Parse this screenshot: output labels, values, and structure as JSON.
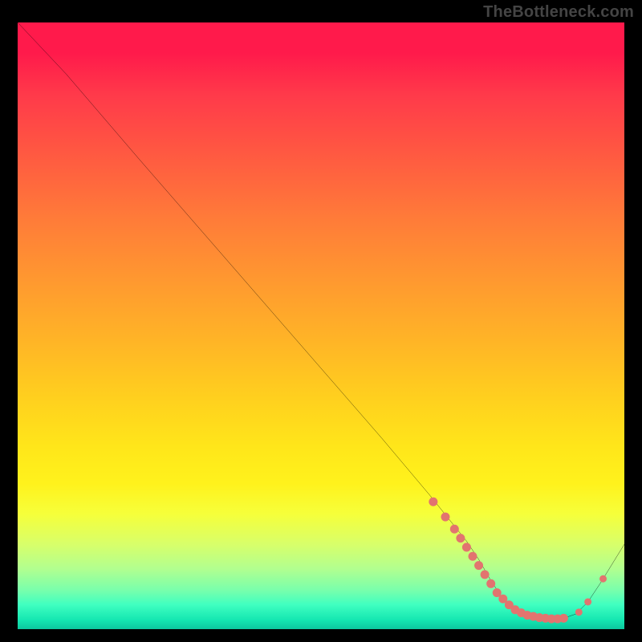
{
  "watermark": "TheBottleneck.com",
  "colors": {
    "dot_fill": "#e2746f",
    "line_stroke": "#000000"
  },
  "chart_data": {
    "type": "line",
    "title": "",
    "xlabel": "",
    "ylabel": "",
    "xlim": [
      0,
      100
    ],
    "ylim": [
      0,
      100
    ],
    "grid": false,
    "series": [
      {
        "name": "curve",
        "x": [
          0,
          8,
          20,
          30,
          40,
          50,
          60,
          68,
          72,
          74,
          76,
          78,
          80,
          82,
          84,
          86,
          88,
          90,
          92,
          94,
          96,
          100
        ],
        "y": [
          100,
          91.5,
          77.5,
          66,
          54.5,
          43,
          31.5,
          22,
          17,
          14.5,
          11.5,
          8,
          5,
          3,
          2.3,
          1.9,
          1.7,
          1.8,
          2.5,
          4.5,
          7.5,
          14
        ]
      }
    ],
    "dots": {
      "name": "highlight-dots",
      "x": [
        68.5,
        70.5,
        72,
        73,
        74,
        75,
        76,
        77,
        78,
        79,
        80,
        81,
        82,
        83,
        84,
        85,
        86,
        87,
        88,
        89,
        90,
        92.5,
        94,
        96.5
      ],
      "y": [
        21,
        18.5,
        16.5,
        15,
        13.5,
        12,
        10.5,
        9,
        7.5,
        6,
        5,
        4,
        3.2,
        2.7,
        2.3,
        2.1,
        1.9,
        1.8,
        1.7,
        1.7,
        1.8,
        2.8,
        4.5,
        8.3
      ],
      "r": [
        5.5,
        5.5,
        5.5,
        5.5,
        5.5,
        5.5,
        5.5,
        5.5,
        5.5,
        5.5,
        5.5,
        5.5,
        5.5,
        5.5,
        5.5,
        5.5,
        5.5,
        5.5,
        5.5,
        5.5,
        5.5,
        4.5,
        4.5,
        4.5
      ]
    }
  }
}
